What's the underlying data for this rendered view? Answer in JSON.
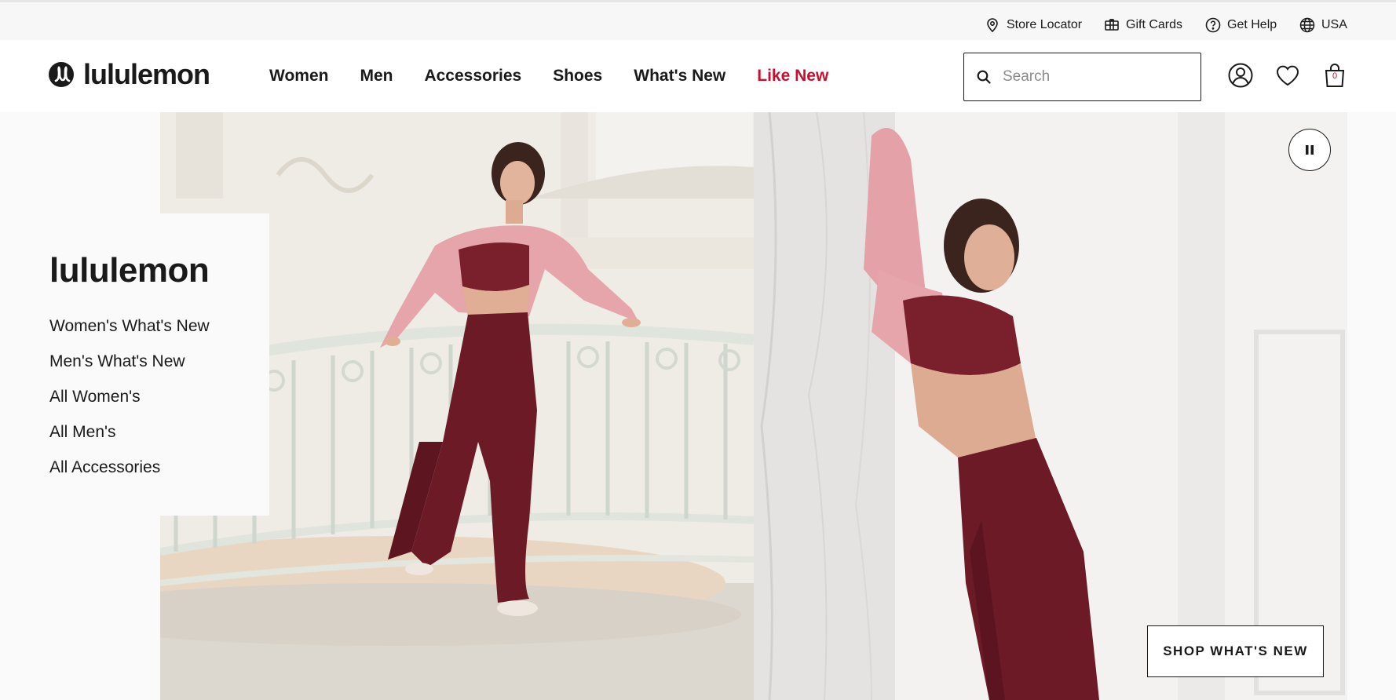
{
  "utility_bar": {
    "items": [
      {
        "label": "Store Locator",
        "icon": "location-pin-icon"
      },
      {
        "label": "Gift Cards",
        "icon": "gift-card-icon"
      },
      {
        "label": "Get Help",
        "icon": "help-circle-icon"
      },
      {
        "label": "USA",
        "icon": "globe-icon"
      }
    ]
  },
  "header": {
    "brand": "lululemon",
    "nav": [
      {
        "label": "Women"
      },
      {
        "label": "Men"
      },
      {
        "label": "Accessories"
      },
      {
        "label": "Shoes"
      },
      {
        "label": "What's New"
      },
      {
        "label": "Like New"
      }
    ],
    "search": {
      "placeholder": "Search"
    },
    "bag_count": "0"
  },
  "hero": {
    "panel": {
      "title": "lululemon",
      "links": [
        "Women's What's New",
        "Men's What's New",
        "All Women's",
        "All Men's",
        "All Accessories"
      ]
    },
    "cta_label": "SHOP WHAT'S NEW"
  },
  "colors": {
    "text": "#1a1a1a",
    "accent": "#c8102e",
    "garment": "#6b1a26",
    "cardigan": "#e6a4ab"
  }
}
